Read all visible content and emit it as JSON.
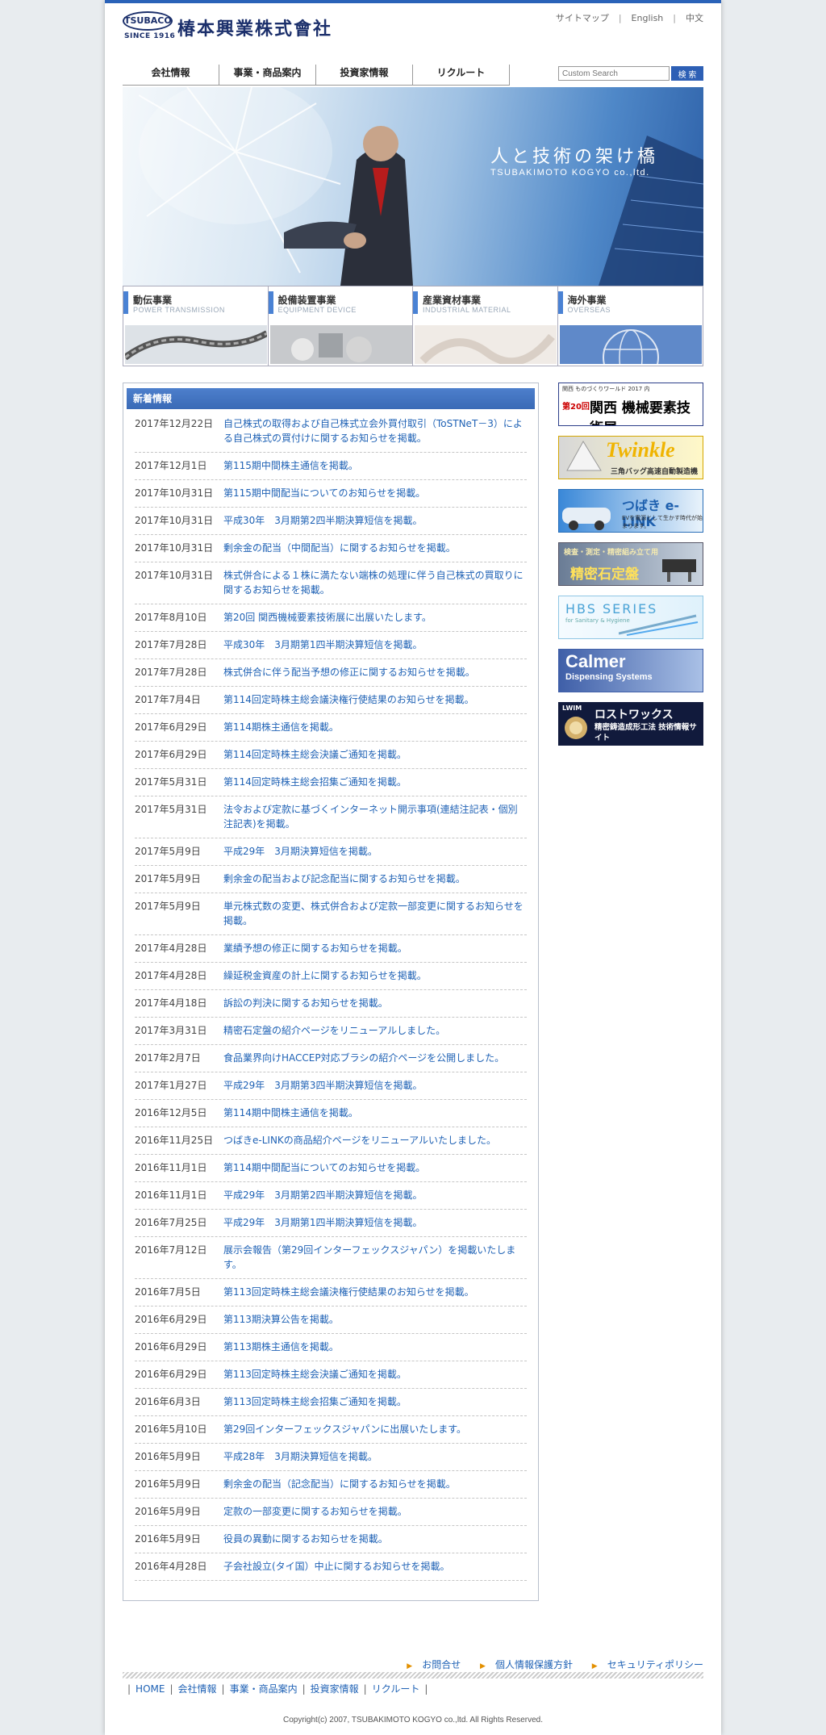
{
  "header": {
    "logo_badge": "TSUBACO",
    "logo_since": "SINCE 1916",
    "company_name": "椿本興業株式會社",
    "top_links": [
      "サイトマップ",
      "English",
      "中文"
    ]
  },
  "gnav": [
    "会社情報",
    "事業・商品案内",
    "投資家情報",
    "リクルート"
  ],
  "search": {
    "placeholder": "Custom Search",
    "button": "検 索"
  },
  "hero": {
    "title": "人と技術の架け橋",
    "subtitle": "TSUBAKIMOTO KOGYO co.,ltd."
  },
  "divisions": [
    {
      "jp": "動伝事業",
      "en": "POWER TRANSMISSION"
    },
    {
      "jp": "設備装置事業",
      "en": "EQUIPMENT DEVICE"
    },
    {
      "jp": "産業資材事業",
      "en": "INDUSTRIAL MATERIAL"
    },
    {
      "jp": "海外事業",
      "en": "OVERSEAS"
    }
  ],
  "news": {
    "heading": "新着情報",
    "items": [
      {
        "date": "2017年12月22日",
        "title": "自己株式の取得および自己株式立会外買付取引（ToSTNeT－3）による自己株式の買付けに関するお知らせを掲載。"
      },
      {
        "date": "2017年12月1日",
        "title": "第115期中間株主通信を掲載。"
      },
      {
        "date": "2017年10月31日",
        "title": "第115期中間配当についてのお知らせを掲載。"
      },
      {
        "date": "2017年10月31日",
        "title": "平成30年　3月期第2四半期決算短信を掲載。"
      },
      {
        "date": "2017年10月31日",
        "title": "剰余金の配当（中間配当）に関するお知らせを掲載。"
      },
      {
        "date": "2017年10月31日",
        "title": "株式併合による１株に満たない端株の処理に伴う自己株式の買取りに関するお知らせを掲載。"
      },
      {
        "date": "2017年8月10日",
        "title": "第20回 関西機械要素技術展に出展いたします。"
      },
      {
        "date": "2017年7月28日",
        "title": "平成30年　3月期第1四半期決算短信を掲載。"
      },
      {
        "date": "2017年7月28日",
        "title": "株式併合に伴う配当予想の修正に関するお知らせを掲載。"
      },
      {
        "date": "2017年7月4日",
        "title": "第114回定時株主総会議決権行使結果のお知らせを掲載。"
      },
      {
        "date": "2017年6月29日",
        "title": "第114期株主通信を掲載。"
      },
      {
        "date": "2017年6月29日",
        "title": "第114回定時株主総会決議ご通知を掲載。"
      },
      {
        "date": "2017年5月31日",
        "title": "第114回定時株主総会招集ご通知を掲載。"
      },
      {
        "date": "2017年5月31日",
        "title": "法令および定款に基づくインターネット開示事項(連結注記表・個別注記表)を掲載。"
      },
      {
        "date": "2017年5月9日",
        "title": "平成29年　3月期決算短信を掲載。"
      },
      {
        "date": "2017年5月9日",
        "title": "剰余金の配当および記念配当に関するお知らせを掲載。"
      },
      {
        "date": "2017年5月9日",
        "title": "単元株式数の変更、株式併合および定款一部変更に関するお知らせを掲載。"
      },
      {
        "date": "2017年4月28日",
        "title": "業績予想の修正に関するお知らせを掲載。"
      },
      {
        "date": "2017年4月28日",
        "title": "繰延税金資産の計上に関するお知らせを掲載。"
      },
      {
        "date": "2017年4月18日",
        "title": "訴訟の判決に関するお知らせを掲載。"
      },
      {
        "date": "2017年3月31日",
        "title": "精密石定盤の紹介ページをリニューアルしました。"
      },
      {
        "date": "2017年2月7日",
        "title": "食品業界向けHACCEP対応ブラシの紹介ページを公開しました。"
      },
      {
        "date": "2017年1月27日",
        "title": "平成29年　3月期第3四半期決算短信を掲載。"
      },
      {
        "date": "2016年12月5日",
        "title": "第114期中間株主通信を掲載。"
      },
      {
        "date": "2016年11月25日",
        "title": "つばきe-LINKの商品紹介ページをリニューアルいたしました。"
      },
      {
        "date": "2016年11月1日",
        "title": "第114期中間配当についてのお知らせを掲載。"
      },
      {
        "date": "2016年11月1日",
        "title": "平成29年　3月期第2四半期決算短信を掲載。"
      },
      {
        "date": "2016年7月25日",
        "title": "平成29年　3月期第1四半期決算短信を掲載。"
      },
      {
        "date": "2016年7月12日",
        "title": "展示会報告（第29回インターフェックスジャパン）を掲載いたします。"
      },
      {
        "date": "2016年7月5日",
        "title": "第113回定時株主総会議決権行使結果のお知らせを掲載。"
      },
      {
        "date": "2016年6月29日",
        "title": "第113期決算公告を掲載。"
      },
      {
        "date": "2016年6月29日",
        "title": "第113期株主通信を掲載。"
      },
      {
        "date": "2016年6月29日",
        "title": "第113回定時株主総会決議ご通知を掲載。"
      },
      {
        "date": "2016年6月3日",
        "title": "第113回定時株主総会招集ご通知を掲載。"
      },
      {
        "date": "2016年5月10日",
        "title": "第29回インターフェックスジャパンに出展いたします。"
      },
      {
        "date": "2016年5月9日",
        "title": "平成28年　3月期決算短信を掲載。"
      },
      {
        "date": "2016年5月9日",
        "title": "剰余金の配当（記念配当）に関するお知らせを掲載。"
      },
      {
        "date": "2016年5月9日",
        "title": "定款の一部変更に関するお知らせを掲載。"
      },
      {
        "date": "2016年5月9日",
        "title": "役員の異動に関するお知らせを掲載。"
      },
      {
        "date": "2016年4月28日",
        "title": "子会社設立(タイ国）中止に関するお知らせを掲載。"
      }
    ]
  },
  "banners": [
    {
      "label": "関西 機械要素技術展",
      "top_text": "関西 ものづくりワールド 2017 内",
      "edition": "第20回"
    },
    {
      "label": "Twinkle",
      "sub": "三角バッグ高速自動製造機"
    },
    {
      "label": "つばき e-LINK",
      "sub": "EVを電源として生かす時代が始まります。"
    },
    {
      "label": "精密石定盤",
      "top_text": "検査・測定・精密組み立て用"
    },
    {
      "label": "HBS SERIES",
      "sub": "for Sanitary & Hygiene"
    },
    {
      "label": "Calmer",
      "sub": "Dispensing Systems"
    },
    {
      "label": "ロストワックス",
      "sub": "精密鋳造成形工法 技術情報サイト",
      "badge": "LWIM"
    }
  ],
  "footer": {
    "links": [
      "お問合せ",
      "個人情報保護方針",
      "セキュリティポリシー"
    ],
    "nav": [
      "HOME",
      "会社情報",
      "事業・商品案内",
      "投資家情報",
      "リクルート"
    ],
    "copyright": "Copyright(c) 2007, TSUBAKIMOTO KOGYO co.,ltd. All Rights Reserved."
  },
  "colors": {
    "accent": "#2a62b8",
    "link": "#1f62b5",
    "footer_arrow": "#e39000"
  }
}
